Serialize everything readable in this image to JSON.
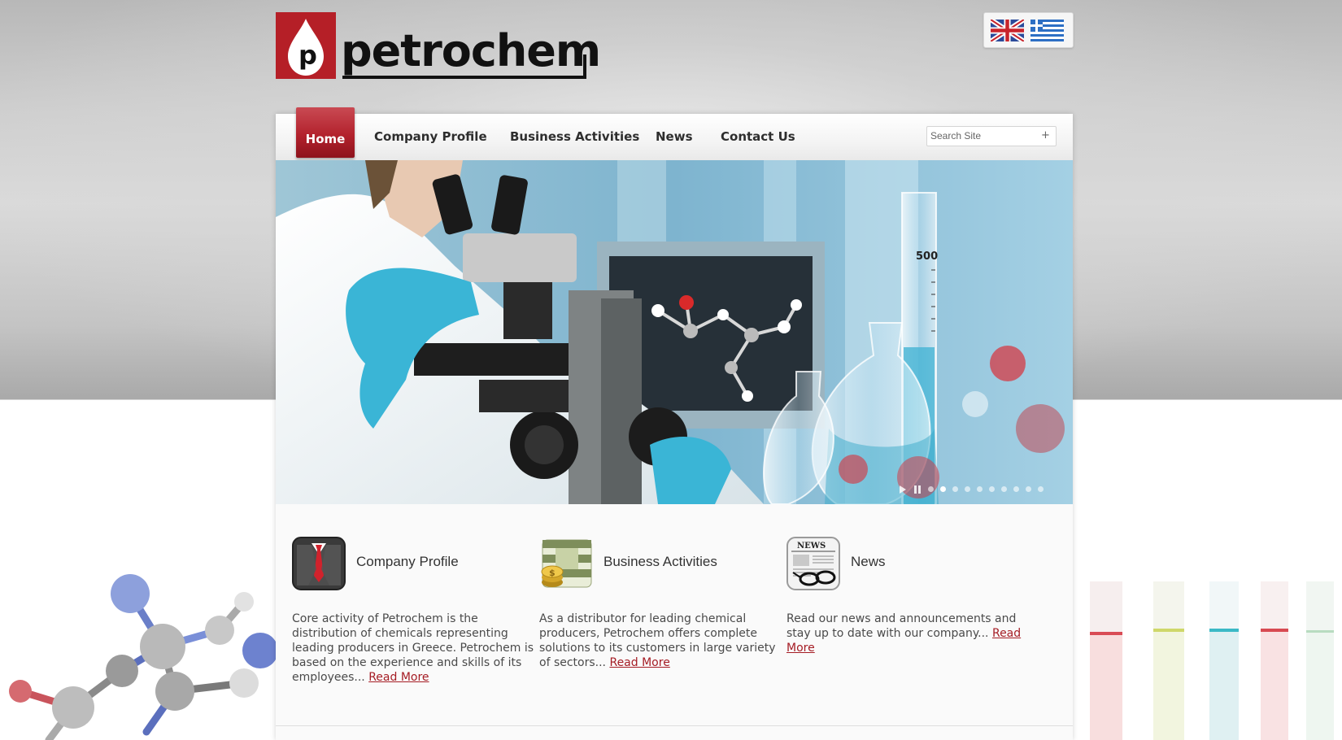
{
  "brand": {
    "logo_text": "petrochem",
    "colors": {
      "accent": "#b3222d",
      "text": "#2e2e2e",
      "link": "#a51c24"
    }
  },
  "languages": [
    {
      "icon": "uk-flag-icon"
    },
    {
      "icon": "greek-flag-icon"
    }
  ],
  "nav": {
    "items": [
      {
        "label": "Home",
        "active": true
      },
      {
        "label": "Company Profile"
      },
      {
        "label": "Business Activities"
      },
      {
        "label": "News"
      },
      {
        "label": "Contact Us"
      }
    ]
  },
  "search": {
    "placeholder": "Search Site",
    "button_icon": "plus-icon"
  },
  "slider": {
    "image_label": "500",
    "controls": {
      "play_icon": "play-icon",
      "pause_icon": "pause-icon",
      "dot_count": 10,
      "active_dot": 1
    }
  },
  "features": [
    {
      "icon": "businessman-suit-icon",
      "title": "Company Profile",
      "text": "Core activity of Petrochem is the distribution of chemicals representing leading producers in Greece. Petrochem is based on the experience and skills of its employees... ",
      "link": "Read More"
    },
    {
      "icon": "money-coins-icon",
      "title": "Business Activities",
      "text": "As a distributor for leading chemical producers, Petrochem offers complete solutions to its customers in large variety of sectors... ",
      "link": "Read More"
    },
    {
      "icon": "newspaper-glasses-icon",
      "title": "News",
      "text": "Read our news and announcements and stay up to date with our company... ",
      "link": "Read More",
      "icon_label": "NEWS"
    }
  ]
}
